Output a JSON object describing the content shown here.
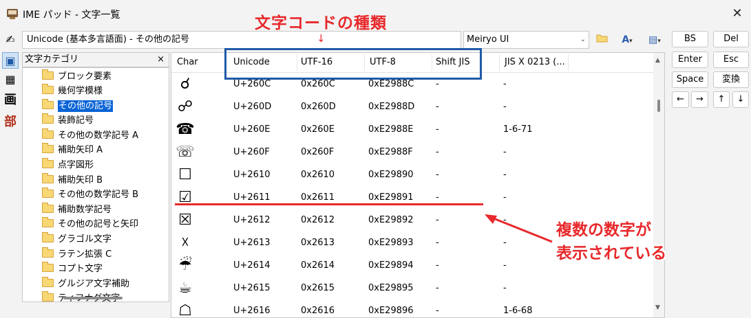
{
  "window": {
    "title": "IME パッド - 文字一覧",
    "close_glyph": "✕"
  },
  "toolstrip": {
    "items": [
      {
        "icon": "handwriting-icon",
        "glyph": "✍"
      },
      {
        "icon": "char-list-icon",
        "glyph": "▣"
      },
      {
        "icon": "keyboard-icon",
        "glyph": "▦"
      },
      {
        "icon": "stroke-count-kanji",
        "glyph": "画"
      },
      {
        "icon": "radical-kanji",
        "glyph": "部"
      }
    ]
  },
  "toolbar": {
    "category_combo": "Unicode (基本多言語面) - その他の記号",
    "font_combo": "Meiryo UI",
    "font_chevron": "⌄",
    "open_folder_glyph": "📂",
    "font_style_glyph": "A",
    "view_glyph": "▤"
  },
  "tree": {
    "header": "文字カテゴリ",
    "close_glyph": "×",
    "items": [
      {
        "label": "ブロック要素",
        "selected": false
      },
      {
        "label": "幾何学模様",
        "selected": false
      },
      {
        "label": "その他の記号",
        "selected": true
      },
      {
        "label": "装飾記号",
        "selected": false
      },
      {
        "label": "その他の数学記号 A",
        "selected": false
      },
      {
        "label": "補助矢印 A",
        "selected": false
      },
      {
        "label": "点字図形",
        "selected": false
      },
      {
        "label": "補助矢印 B",
        "selected": false
      },
      {
        "label": "その他の数学記号 B",
        "selected": false
      },
      {
        "label": "補助数学記号",
        "selected": false
      },
      {
        "label": "その他の記号と矢印",
        "selected": false
      },
      {
        "label": "グラゴル文字",
        "selected": false
      },
      {
        "label": "ラテン拡張 C",
        "selected": false
      },
      {
        "label": "コプト文字",
        "selected": false
      },
      {
        "label": "グルジア文字補助",
        "selected": false
      },
      {
        "label": "ティフナグ文字",
        "selected": false
      }
    ]
  },
  "grid": {
    "columns": [
      "Char",
      "Unicode",
      "UTF-16",
      "UTF-8",
      "Shift JIS",
      "JIS X 0213 (..."
    ],
    "rows": [
      {
        "char": "☌",
        "unicode": "U+260C",
        "utf16": "0x260C",
        "utf8": "0xE2988C",
        "sjis": "-",
        "jis": "-"
      },
      {
        "char": "☍",
        "unicode": "U+260D",
        "utf16": "0x260D",
        "utf8": "0xE2988D",
        "sjis": "-",
        "jis": "-"
      },
      {
        "char": "☎",
        "unicode": "U+260E",
        "utf16": "0x260E",
        "utf8": "0xE2988E",
        "sjis": "-",
        "jis": "1-6-71"
      },
      {
        "char": "☏",
        "unicode": "U+260F",
        "utf16": "0x260F",
        "utf8": "0xE2988F",
        "sjis": "-",
        "jis": "-"
      },
      {
        "char": "☐",
        "unicode": "U+2610",
        "utf16": "0x2610",
        "utf8": "0xE29890",
        "sjis": "-",
        "jis": "-"
      },
      {
        "char": "☑",
        "unicode": "U+2611",
        "utf16": "0x2611",
        "utf8": "0xE29891",
        "sjis": "-",
        "jis": "-"
      },
      {
        "char": "☒",
        "unicode": "U+2612",
        "utf16": "0x2612",
        "utf8": "0xE29892",
        "sjis": "-",
        "jis": "-"
      },
      {
        "char": "☓",
        "unicode": "U+2613",
        "utf16": "0x2613",
        "utf8": "0xE29893",
        "sjis": "-",
        "jis": "-"
      },
      {
        "char": "☔",
        "unicode": "U+2614",
        "utf16": "0x2614",
        "utf8": "0xE29894",
        "sjis": "-",
        "jis": "-"
      },
      {
        "char": "☕",
        "unicode": "U+2615",
        "utf16": "0x2615",
        "utf8": "0xE29895",
        "sjis": "-",
        "jis": "-"
      },
      {
        "char": "☖",
        "unicode": "U+2616",
        "utf16": "0x2616",
        "utf8": "0xE29896",
        "sjis": "-",
        "jis": "1-6-68"
      }
    ]
  },
  "keys": {
    "bs": "BS",
    "del": "Del",
    "enter": "Enter",
    "esc": "Esc",
    "space": "Space",
    "henkan": "変換",
    "left": "←",
    "right": "→",
    "up": "↑",
    "down": "↓"
  },
  "annotations": {
    "title": "文字コードの種類",
    "note_line1": "複数の数字が",
    "note_line2": "表示されている",
    "arrow_down": "↓",
    "color": "#e8282b",
    "box_color": "#1f5aa8"
  }
}
